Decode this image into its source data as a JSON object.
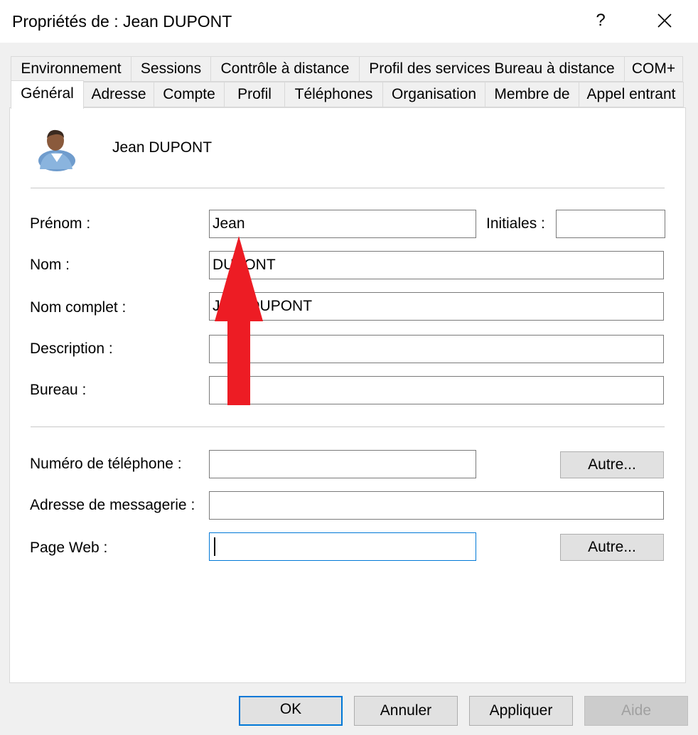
{
  "window": {
    "title": "Propriétés de : Jean DUPONT",
    "help_label": "?",
    "close_icon": "close-icon"
  },
  "tabs_row1": [
    "Environnement",
    "Sessions",
    "Contrôle à distance",
    "Profil des services Bureau à distance",
    "COM+"
  ],
  "tabs_row2": [
    "Général",
    "Adresse",
    "Compte",
    "Profil",
    "Téléphones",
    "Organisation",
    "Membre de",
    "Appel entrant"
  ],
  "active_tab": "Général",
  "user": {
    "display_name": "Jean DUPONT",
    "avatar_icon": "user-icon"
  },
  "fields": {
    "prenom": {
      "label": "Prénom :",
      "value": "Jean"
    },
    "initiales": {
      "label": "Initiales :",
      "value": ""
    },
    "nom": {
      "label": "Nom :",
      "value": "DUPONT"
    },
    "nom_complet": {
      "label": "Nom complet :",
      "value": "Jean DUPONT"
    },
    "description": {
      "label": "Description :",
      "value": ""
    },
    "bureau": {
      "label": "Bureau :",
      "value": ""
    },
    "telephone": {
      "label": "Numéro de téléphone :",
      "value": "",
      "other_button": "Autre..."
    },
    "messagerie": {
      "label": "Adresse de messagerie :",
      "value": ""
    },
    "page_web": {
      "label": "Page Web :",
      "value": "",
      "other_button": "Autre..."
    }
  },
  "footer": {
    "ok": "OK",
    "cancel": "Annuler",
    "apply": "Appliquer",
    "help": "Aide"
  },
  "annotation": {
    "arrow_color": "#ed1c24",
    "arrow_icon": "arrow-up-icon"
  },
  "colors": {
    "focus_border": "#0078d7",
    "dialog_bg": "#f0f0f0"
  }
}
